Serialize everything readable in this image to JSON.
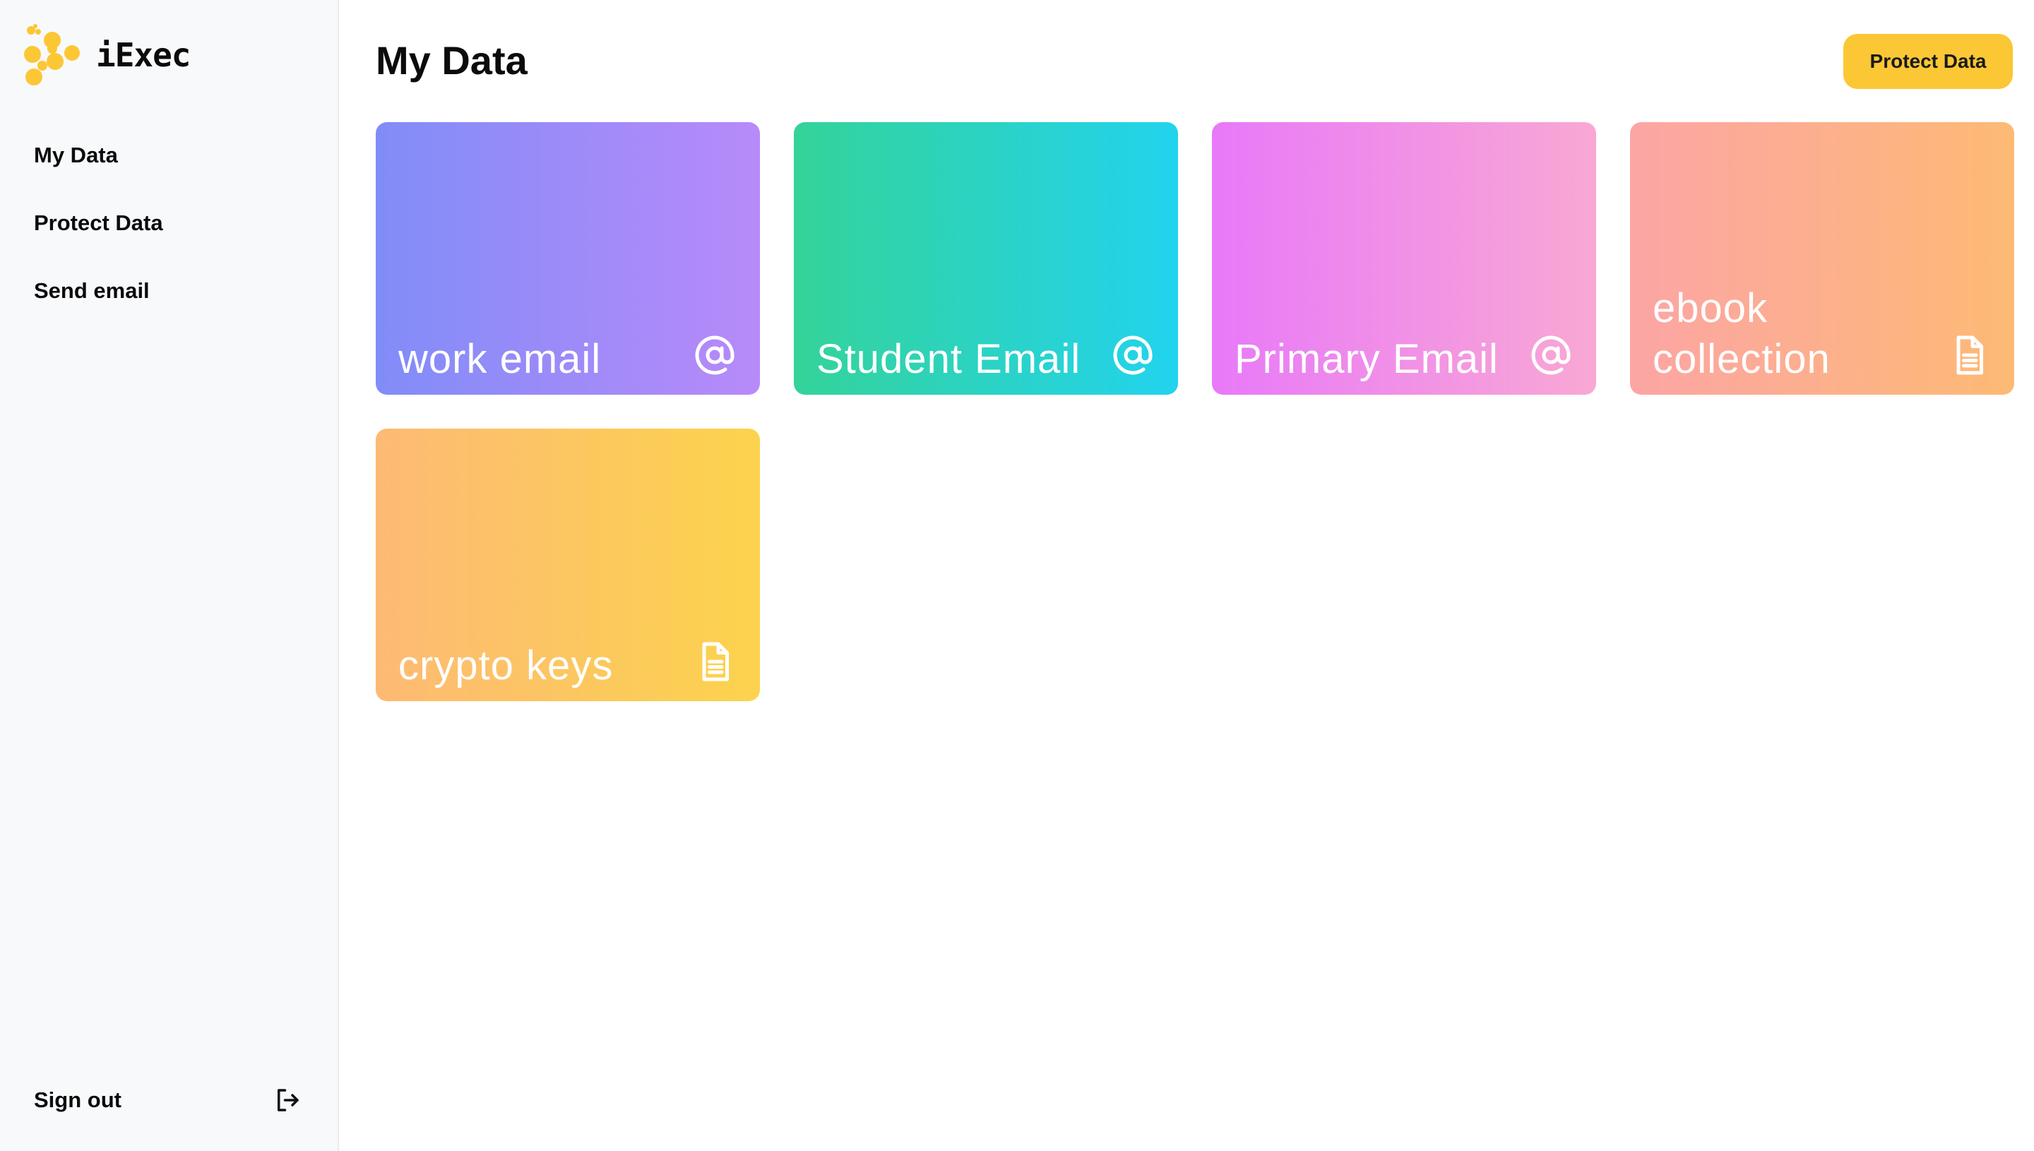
{
  "brand": {
    "name": "iExec",
    "logo_color": "#fcc735"
  },
  "sidebar": {
    "items": [
      {
        "label": "My Data"
      },
      {
        "label": "Protect Data"
      },
      {
        "label": "Send email"
      }
    ],
    "signout_label": "Sign out",
    "signout_icon": "sign-out-icon"
  },
  "header": {
    "title": "My Data",
    "protect_button_label": "Protect Data",
    "protect_button_color": "#fcc735"
  },
  "cards": [
    {
      "label": "work email",
      "icon": "at-icon",
      "gradient": [
        "#818cf8",
        "#b88af9"
      ]
    },
    {
      "label": "Student Email",
      "icon": "at-icon",
      "gradient": [
        "#34d399",
        "#22d3ee"
      ]
    },
    {
      "label": "Primary Email",
      "icon": "at-icon",
      "gradient": [
        "#e879f9",
        "#f9a8d4"
      ]
    },
    {
      "label": "ebook collection",
      "icon": "document-icon",
      "gradient": [
        "#fca5a5",
        "#fdba74"
      ]
    },
    {
      "label": "crypto keys",
      "icon": "document-icon",
      "gradient": [
        "#fdba74",
        "#fcd34d"
      ]
    }
  ]
}
